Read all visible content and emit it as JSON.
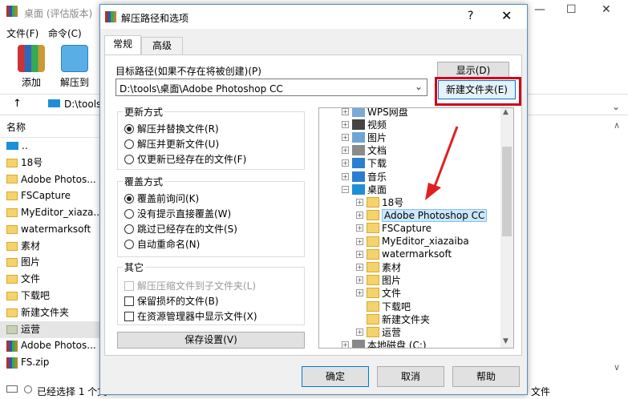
{
  "background_window": {
    "title": "桌面 (评估版本)",
    "menu": [
      "文件(F)",
      "命令(C)"
    ],
    "toolbar": [
      {
        "label": "添加",
        "icon": "rar-add-icon"
      },
      {
        "label": "解压到",
        "icon": "extract-folder-icon"
      }
    ],
    "address": "D:\\tools",
    "column_header": "名称",
    "items": [
      {
        "label": "..",
        "icon": "drive"
      },
      {
        "label": "18号",
        "icon": "folder"
      },
      {
        "label": "Adobe Photos...",
        "icon": "folder"
      },
      {
        "label": "FSCapture",
        "icon": "folder"
      },
      {
        "label": "MyEditor_xiaza...",
        "icon": "folder"
      },
      {
        "label": "watermarksoft",
        "icon": "folder"
      },
      {
        "label": "素材",
        "icon": "folder"
      },
      {
        "label": "图片",
        "icon": "folder"
      },
      {
        "label": "文件",
        "icon": "folder"
      },
      {
        "label": "下载吧",
        "icon": "folder"
      },
      {
        "label": "新建文件夹",
        "icon": "folder"
      },
      {
        "label": "运营",
        "icon": "folder-gray"
      },
      {
        "label": "Adobe Photos...",
        "icon": "zip"
      },
      {
        "label": "FS.zip",
        "icon": "zip"
      }
    ],
    "status": "已经选择 1 个文",
    "status_right": "文件"
  },
  "dialog": {
    "title": "解压路径和选项",
    "help_glyph": "?",
    "close_glyph": "✕",
    "tabs": [
      "常规",
      "高级"
    ],
    "dest_label": "目标路径(如果不存在将被创建)(P)",
    "dest_value": "D:\\tools\\桌面\\Adobe Photoshop CC",
    "show_button": "显示(D)",
    "new_folder_button": "新建文件夹(E)",
    "update_group": {
      "label": "更新方式",
      "options": [
        "解压并替换文件(R)",
        "解压并更新文件(U)",
        "仅更新已经存在的文件(F)"
      ],
      "selected": 0
    },
    "overwrite_group": {
      "label": "覆盖方式",
      "options": [
        "覆盖前询问(K)",
        "没有提示直接覆盖(W)",
        "跳过已经存在的文件(S)",
        "自动重命名(N)"
      ],
      "selected": 0
    },
    "misc_group": {
      "label": "其它",
      "options": [
        "解压压缩文件到子文件夹(L)",
        "保留损坏的文件(B)",
        "在资源管理器中显示文件(X)"
      ]
    },
    "save_button": "保存设置(V)",
    "tree": [
      {
        "label": "WPS网盘",
        "icon": "cloud-icon",
        "level": 1,
        "expander": "+"
      },
      {
        "label": "视频",
        "icon": "video-icon",
        "level": 1,
        "expander": "+"
      },
      {
        "label": "图片",
        "icon": "picture-icon",
        "level": 1,
        "expander": "+"
      },
      {
        "label": "文档",
        "icon": "document-icon",
        "level": 1,
        "expander": "+"
      },
      {
        "label": "下载",
        "icon": "download-icon",
        "level": 1,
        "expander": "+"
      },
      {
        "label": "音乐",
        "icon": "music-icon",
        "level": 1,
        "expander": "+"
      },
      {
        "label": "桌面",
        "icon": "desktop-icon",
        "level": 1,
        "expander": "−"
      },
      {
        "label": "18号",
        "icon": "folder-icon",
        "level": 2,
        "expander": "+"
      },
      {
        "label": "Adobe Photoshop CC",
        "icon": "folder-icon",
        "level": 2,
        "expander": "+",
        "selected": true
      },
      {
        "label": "FSCapture",
        "icon": "folder-icon",
        "level": 2,
        "expander": "+"
      },
      {
        "label": "MyEditor_xiazaiba",
        "icon": "folder-icon",
        "level": 2,
        "expander": "+"
      },
      {
        "label": "watermarksoft",
        "icon": "folder-icon",
        "level": 2,
        "expander": "+"
      },
      {
        "label": "素材",
        "icon": "folder-icon",
        "level": 2,
        "expander": "+"
      },
      {
        "label": "图片",
        "icon": "folder-icon",
        "level": 2,
        "expander": "+"
      },
      {
        "label": "文件",
        "icon": "folder-icon",
        "level": 2,
        "expander": "+"
      },
      {
        "label": "下载吧",
        "icon": "folder-icon",
        "level": 2,
        "expander": ""
      },
      {
        "label": "新建文件夹",
        "icon": "folder-icon",
        "level": 2,
        "expander": ""
      },
      {
        "label": "运营",
        "icon": "folder-icon",
        "level": 2,
        "expander": "+"
      },
      {
        "label": "本地磁盘 (C:)",
        "icon": "drive-icon",
        "level": 1,
        "expander": "+"
      }
    ],
    "ok_button": "确定",
    "cancel_button": "取消",
    "help_button": "帮助"
  },
  "colors": {
    "highlight_box": "#d0021b",
    "arrow": "#e02020",
    "selection": "#cce8ff",
    "dialog_border": "#5f8bb8"
  }
}
